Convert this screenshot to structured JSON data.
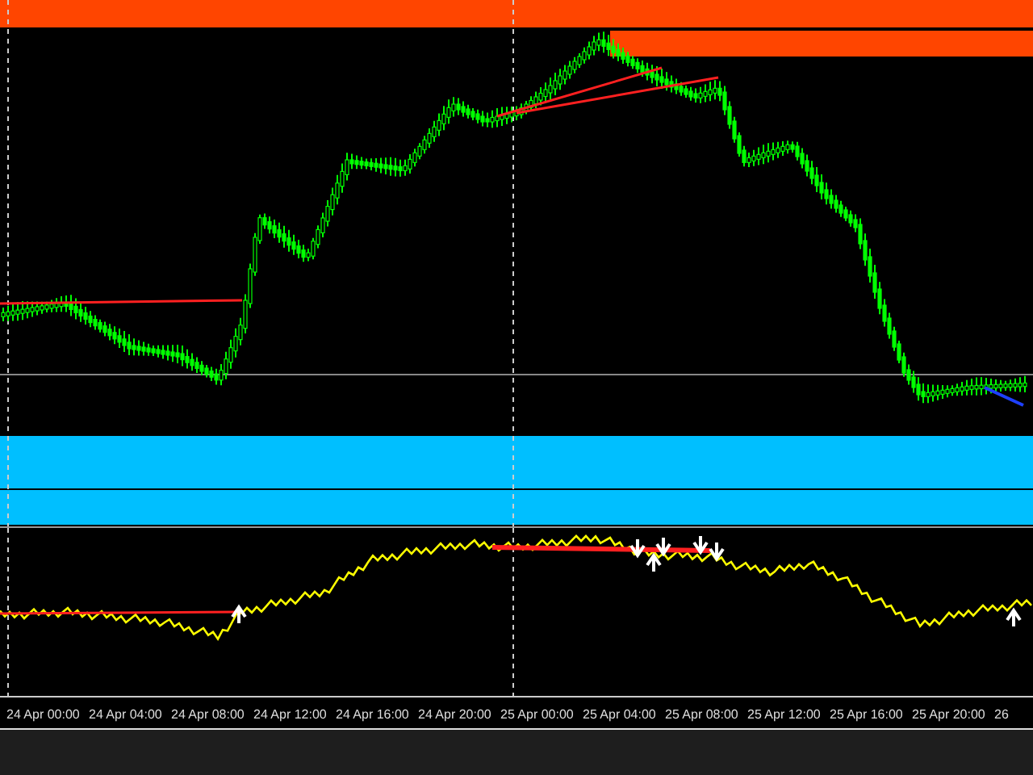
{
  "time_axis": {
    "labels": [
      "24 Apr 00:00",
      "24 Apr 04:00",
      "24 Apr 08:00",
      "24 Apr 12:00",
      "24 Apr 16:00",
      "24 Apr 20:00",
      "25 Apr 00:00",
      "25 Apr 04:00",
      "25 Apr 08:00",
      "25 Apr 12:00",
      "25 Apr 16:00",
      "25 Apr 20:00",
      "26"
    ]
  }
}
